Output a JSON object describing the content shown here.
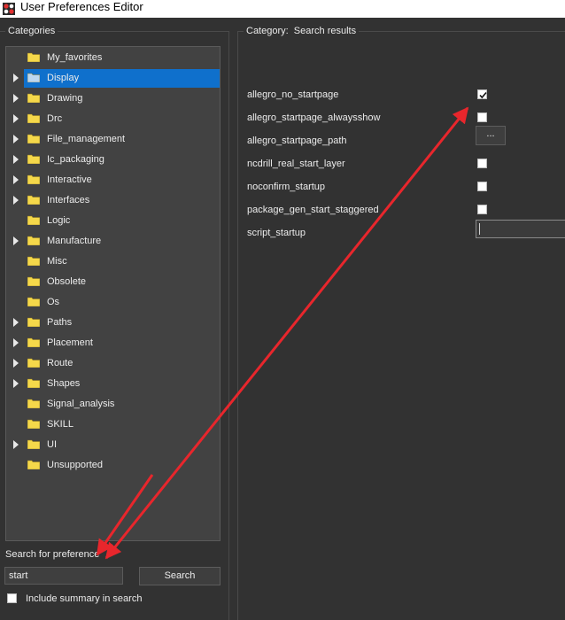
{
  "window": {
    "title": "User Preferences Editor",
    "icon": "app-logo-icon"
  },
  "categories": {
    "group_title": "Categories",
    "items": [
      {
        "label": "My_favorites",
        "expandable": false,
        "selected": false
      },
      {
        "label": "Display",
        "expandable": true,
        "selected": true
      },
      {
        "label": "Drawing",
        "expandable": true,
        "selected": false
      },
      {
        "label": "Drc",
        "expandable": true,
        "selected": false
      },
      {
        "label": "File_management",
        "expandable": true,
        "selected": false
      },
      {
        "label": "Ic_packaging",
        "expandable": true,
        "selected": false
      },
      {
        "label": "Interactive",
        "expandable": true,
        "selected": false
      },
      {
        "label": "Interfaces",
        "expandable": true,
        "selected": false
      },
      {
        "label": "Logic",
        "expandable": false,
        "selected": false
      },
      {
        "label": "Manufacture",
        "expandable": true,
        "selected": false
      },
      {
        "label": "Misc",
        "expandable": false,
        "selected": false
      },
      {
        "label": "Obsolete",
        "expandable": false,
        "selected": false
      },
      {
        "label": "Os",
        "expandable": false,
        "selected": false
      },
      {
        "label": "Paths",
        "expandable": true,
        "selected": false
      },
      {
        "label": "Placement",
        "expandable": true,
        "selected": false
      },
      {
        "label": "Route",
        "expandable": true,
        "selected": false
      },
      {
        "label": "Shapes",
        "expandable": true,
        "selected": false
      },
      {
        "label": "Signal_analysis",
        "expandable": false,
        "selected": false
      },
      {
        "label": "SKILL",
        "expandable": false,
        "selected": false
      },
      {
        "label": "UI",
        "expandable": true,
        "selected": false
      },
      {
        "label": "Unsupported",
        "expandable": false,
        "selected": false
      }
    ]
  },
  "search": {
    "label": "Search for preference",
    "value": "start",
    "button_label": "Search",
    "include_summary_label": "Include summary in search",
    "include_summary_checked": false
  },
  "results": {
    "group_title": "Category:  Search results",
    "rows": [
      {
        "name": "allegro_no_startpage",
        "control": "checkbox",
        "checked": true
      },
      {
        "name": "allegro_startpage_alwaysshow",
        "control": "checkbox",
        "checked": false
      },
      {
        "name": "allegro_startpage_path",
        "control": "browse",
        "button_label": "..."
      },
      {
        "name": "ncdrill_real_start_layer",
        "control": "checkbox",
        "checked": false
      },
      {
        "name": "noconfirm_startup",
        "control": "checkbox",
        "checked": false
      },
      {
        "name": "package_gen_start_staggered",
        "control": "checkbox",
        "checked": false
      },
      {
        "name": "script_startup",
        "control": "text",
        "value": ""
      }
    ]
  },
  "colors": {
    "background": "#323232",
    "tree_background": "#424242",
    "selection": "#0f70cc",
    "folder": "#f5d84a",
    "annotation_arrow": "#e8262c"
  }
}
